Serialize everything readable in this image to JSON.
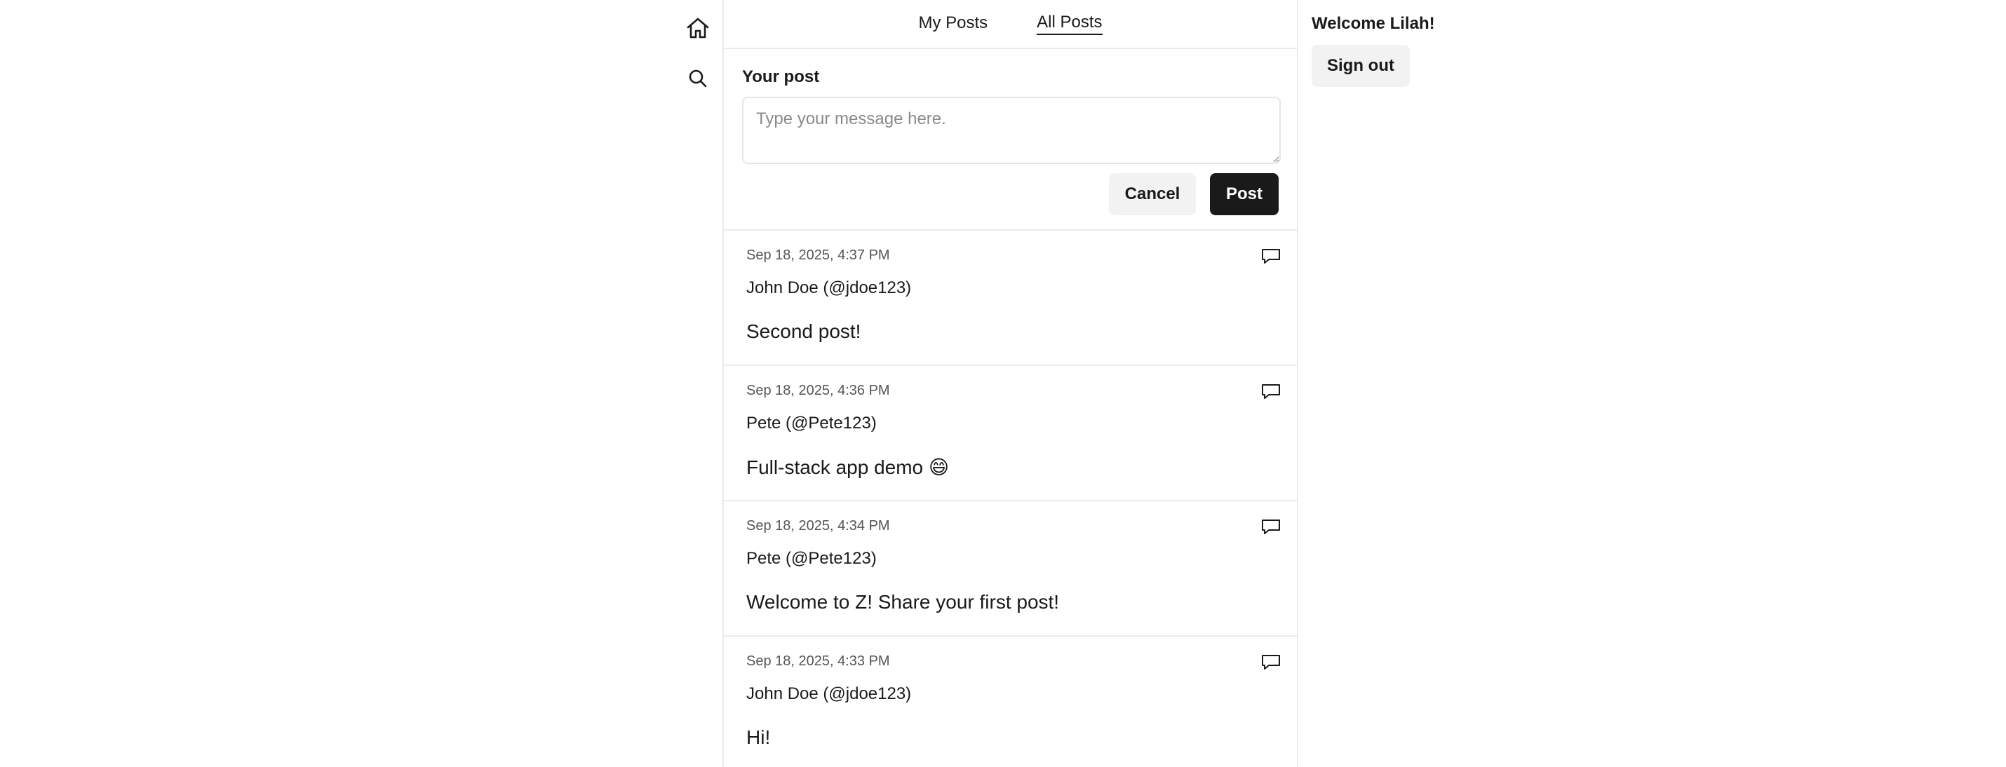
{
  "nav": {
    "home_icon": "home-icon",
    "search_icon": "search-icon"
  },
  "tabs": [
    {
      "label": "My Posts",
      "active": false
    },
    {
      "label": "All Posts",
      "active": true
    }
  ],
  "composer": {
    "label": "Your post",
    "value": "",
    "placeholder": "Type your message here.",
    "cancel_label": "Cancel",
    "post_label": "Post"
  },
  "posts": [
    {
      "time": "Sep 18, 2025, 4:37 PM",
      "author": "John Doe (@jdoe123)",
      "body": "Second post!"
    },
    {
      "time": "Sep 18, 2025, 4:36 PM",
      "author": "Pete (@Pete123)",
      "body": "Full-stack app demo 😄"
    },
    {
      "time": "Sep 18, 2025, 4:34 PM",
      "author": "Pete (@Pete123)",
      "body": "Welcome to Z! Share your first post!"
    },
    {
      "time": "Sep 18, 2025, 4:33 PM",
      "author": "John Doe (@jdoe123)",
      "body": "Hi!"
    }
  ],
  "reply_icon": "comment-icon",
  "user": {
    "welcome": "Welcome Lilah!",
    "signout_label": "Sign out"
  },
  "colors": {
    "primary_button": "#1a1a1a",
    "secondary_button": "#f2f2f2",
    "divider": "#ebebeb"
  }
}
